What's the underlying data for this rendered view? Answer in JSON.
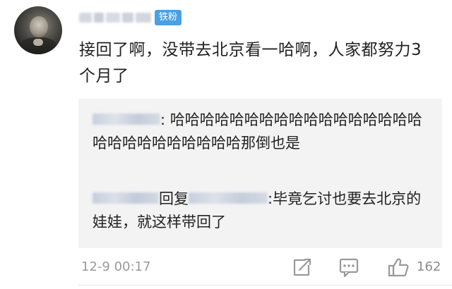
{
  "comment": {
    "badge": "铁粉",
    "text": "接回了啊，没带去北京看一哈啊，人家都努力3个月了",
    "timestamp": "12-9 00:17",
    "likes": "162"
  },
  "replies": [
    {
      "sep": ":",
      "text": " 哈哈哈哈哈哈哈哈哈哈哈哈哈哈哈哈哈哈哈哈哈哈哈哈哈哈哈那倒也是"
    },
    {
      "reply_word": "回复",
      "sep": ":",
      "text": "毕竟乞讨也要去北京的娃娃，就这样带回了"
    }
  ],
  "icons": {
    "share": "share-edit-icon",
    "comment": "comment-icon",
    "like": "thumbs-up-icon"
  }
}
